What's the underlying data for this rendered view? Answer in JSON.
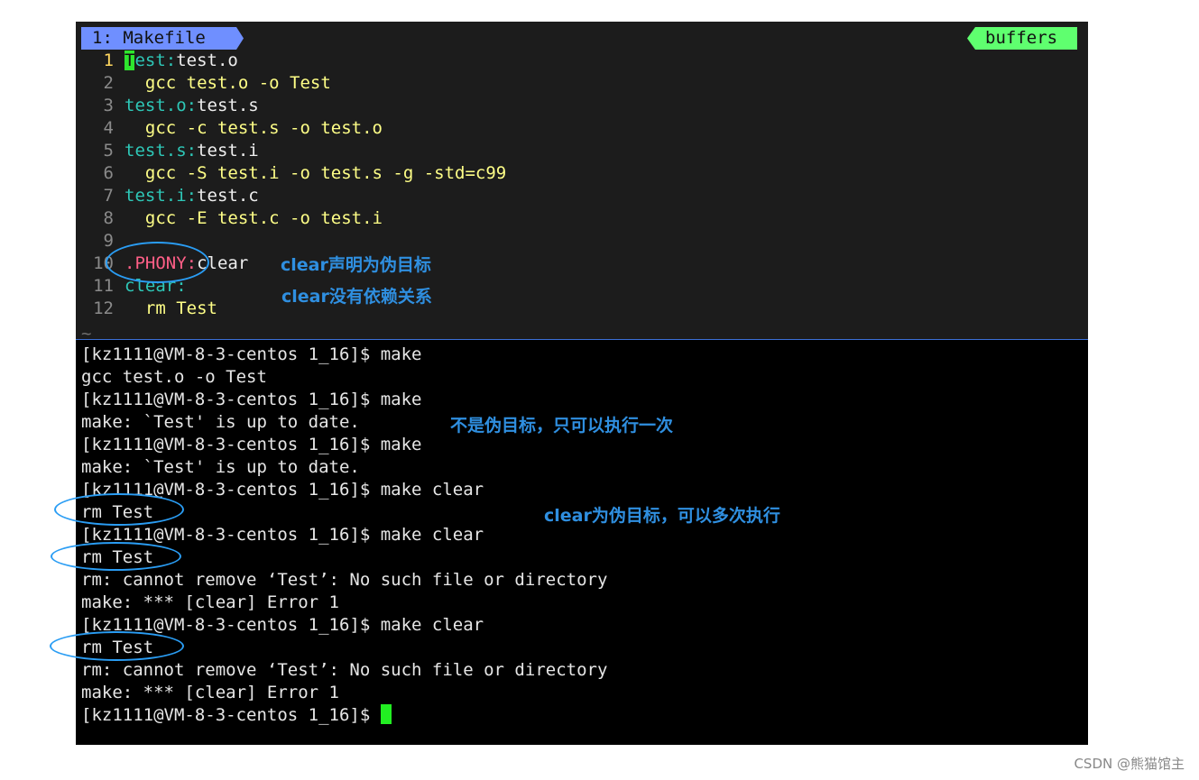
{
  "vim": {
    "tab_active": "1: Makefile",
    "tab_right": "buffers",
    "lines": [
      {
        "num": "1",
        "target": "Test:",
        "dep": "test.o",
        "cmd": ""
      },
      {
        "num": "2",
        "target": "",
        "dep": "",
        "cmd": "  gcc test.o -o Test"
      },
      {
        "num": "3",
        "target": "test.o:",
        "dep": "test.s",
        "cmd": ""
      },
      {
        "num": "4",
        "target": "",
        "dep": "",
        "cmd": "  gcc -c test.s -o test.o"
      },
      {
        "num": "5",
        "target": "test.s:",
        "dep": "test.i",
        "cmd": ""
      },
      {
        "num": "6",
        "target": "",
        "dep": "",
        "cmd": "  gcc -S test.i -o test.s -g -std=c99"
      },
      {
        "num": "7",
        "target": "test.i:",
        "dep": "test.c",
        "cmd": ""
      },
      {
        "num": "8",
        "target": "",
        "dep": "",
        "cmd": "  gcc -E test.c -o test.i"
      },
      {
        "num": "9",
        "target": "",
        "dep": "",
        "cmd": ""
      },
      {
        "num": "10",
        "phony": ".PHONY:",
        "dep": "clear",
        "cmd": ""
      },
      {
        "num": "11",
        "target": "clear:",
        "dep": "",
        "cmd": ""
      },
      {
        "num": "12",
        "target": "",
        "dep": "",
        "cmd": "  rm Test"
      }
    ],
    "tilde": "~"
  },
  "terminal": {
    "lines": [
      "[kz1111@VM-8-3-centos 1_16]$ make",
      "gcc test.o -o Test",
      "[kz1111@VM-8-3-centos 1_16]$ make",
      "make: `Test' is up to date.",
      "[kz1111@VM-8-3-centos 1_16]$ make",
      "make: `Test' is up to date.",
      "[kz1111@VM-8-3-centos 1_16]$ make clear",
      "rm Test",
      "[kz1111@VM-8-3-centos 1_16]$ make clear",
      "rm Test",
      "rm: cannot remove ‘Test’: No such file or directory",
      "make: *** [clear] Error 1",
      "[kz1111@VM-8-3-centos 1_16]$ make clear",
      "rm Test",
      "rm: cannot remove ‘Test’: No such file or directory",
      "make: *** [clear] Error 1",
      "[kz1111@VM-8-3-centos 1_16]$ "
    ]
  },
  "annotations": {
    "phony_decl": "clear声明为伪目标",
    "no_deps": "clear没有依赖关系",
    "not_phony": "不是伪目标，只可以执行一次",
    "clear_phony": "clear为伪目标，可以多次执行"
  },
  "watermark": "CSDN @熊猫馆主",
  "colors": {
    "annotation": "#2f8fe0",
    "tab_active": "#6f8fff",
    "tab_buffers": "#5fff6f",
    "target": "#2ec7b7",
    "command": "#ffff87",
    "phony": "#ff5f87",
    "cursor": "#22ee22"
  }
}
